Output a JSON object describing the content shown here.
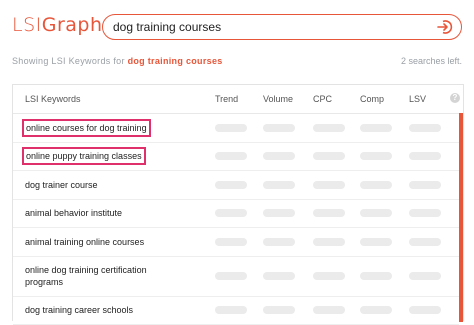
{
  "header": {
    "logo_lsi": "LSI",
    "logo_graph": "Graph",
    "search_value": "dog training courses",
    "go_icon": "submit-arrow-icon"
  },
  "subheader": {
    "prefix": "Showing LSI Keywords for ",
    "query": "dog training courses",
    "count": "2 searches left."
  },
  "table": {
    "columns": [
      "LSI Keywords",
      "Trend",
      "Volume",
      "CPC",
      "Comp",
      "LSV"
    ],
    "info_label": "?",
    "rows": [
      {
        "keyword": "online courses for dog training",
        "highlighted": true
      },
      {
        "keyword": "online puppy training classes",
        "highlighted": true
      },
      {
        "keyword": "dog trainer course",
        "highlighted": false
      },
      {
        "keyword": "animal behavior institute",
        "highlighted": false
      },
      {
        "keyword": "animal training online courses",
        "highlighted": false
      },
      {
        "keyword": "online dog training certification programs",
        "highlighted": false
      },
      {
        "keyword": "dog training career schools",
        "highlighted": false
      }
    ]
  },
  "colors": {
    "accent": "#e8563a",
    "highlight": "#e0306b",
    "placeholder_pill": "#ebebeb"
  }
}
